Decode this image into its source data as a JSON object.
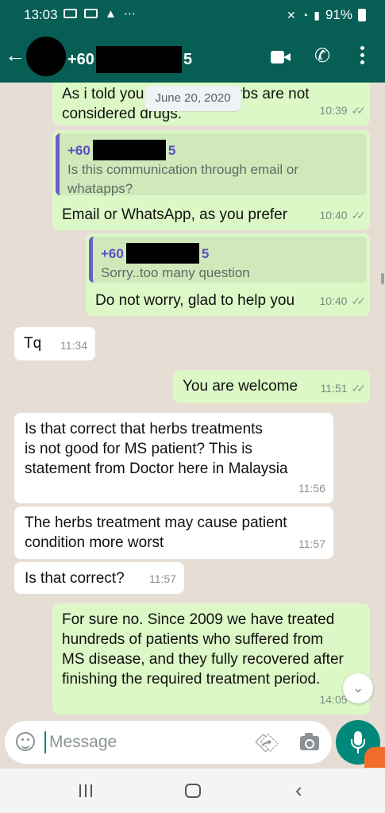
{
  "status_bar": {
    "time": "13:03",
    "battery": "91%"
  },
  "header": {
    "back_glyph": "←",
    "phone_prefix": "+60",
    "phone_suffix": "5",
    "icons": [
      "video-call-icon",
      "phone-icon",
      "more-options-icon"
    ]
  },
  "date_chip": "June 20, 2020",
  "messages": [
    {
      "dir": "out",
      "text": "As i told you, medicinal herbs are not\nconsidered drugs.",
      "time": "10:39"
    },
    {
      "dir": "out",
      "quote": {
        "name_prefix": "+60",
        "name_suffix": "5",
        "text": "Is this communication through email or\nwhatapps?"
      },
      "text": "Email or WhatsApp, as you prefer",
      "time": "10:40"
    },
    {
      "dir": "out",
      "quote": {
        "name_prefix": "+60",
        "name_suffix": "5",
        "text": "Sorry..too many question"
      },
      "text": "Do not worry, glad to help you",
      "time": "10:40"
    },
    {
      "dir": "in",
      "text": "Tq",
      "time": "11:34"
    },
    {
      "dir": "out",
      "text": "You are welcome",
      "time": "11:51"
    },
    {
      "dir": "in",
      "text": "Is that correct that herbs treatments\nis not good for MS patient? This is\nstatement from Doctor here in Malaysia",
      "time": "11:56"
    },
    {
      "dir": "in",
      "text": "The herbs treatment may cause patient\ncondition more worst",
      "time": "11:57"
    },
    {
      "dir": "in",
      "text": "Is that correct?",
      "time": "11:57"
    },
    {
      "dir": "out",
      "text": "For sure no. Since 2009 we have treated\nhundreds of patients who suffered from\nMS disease, and they fully recovered after\nfinishing the required treatment period.",
      "time": "14:05"
    }
  ],
  "composer": {
    "placeholder": "Message"
  },
  "colors": {
    "header": "#075e54",
    "outgoing": "#dcf8c6",
    "incoming": "#ffffff",
    "accent": "#00897b"
  }
}
